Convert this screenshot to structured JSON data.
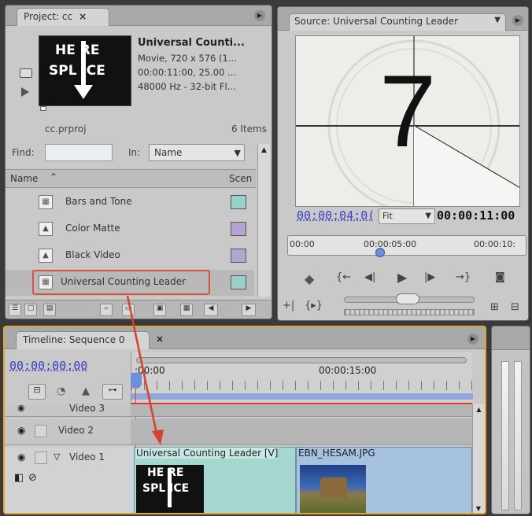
{
  "project": {
    "tab_label": "Project: cc",
    "tab_close": "×",
    "clip_title": "Universal Counti...",
    "clip_line1": "Movie, 720 x 576 (1...",
    "clip_line2": "00:00:11:00, 25.00 ...",
    "clip_line3": "48000 Hz - 32-bit Fl...",
    "thumb_line1": "HE RE",
    "thumb_line2": "SPL ICE",
    "file_name": "cc.prproj",
    "item_count": "6 Items",
    "find_label": "Find:",
    "find_value": "",
    "in_label": "In:",
    "in_value": "Name",
    "col_name": "Name",
    "col_scene": "Scen",
    "items": [
      {
        "label": "Bars and Tone",
        "color": "#9ad0cc"
      },
      {
        "label": "Color Matte",
        "color": "#b3a4d4"
      },
      {
        "label": "Black Video",
        "color": "#b3a4d4"
      },
      {
        "label": "Universal Counting Leader",
        "color": "#9ad0cc"
      }
    ]
  },
  "source": {
    "tab_label": "Source: Universal Counting Leader",
    "preview_number": "7",
    "current_time": "00:00:04:0(",
    "fit_value": "Fit",
    "duration": "00:00:11:00",
    "ruler_start": "00:00",
    "ruler_mid": "00:00:05:00",
    "ruler_end": "00:00:10:"
  },
  "timeline": {
    "tab_label": "Timeline: Sequence 0",
    "tab_close": "×",
    "current_time": "00:00:00:00",
    "ruler_start": ":00:00",
    "ruler_mid": "00:00:15:00",
    "tracks": {
      "video3": "Video 3",
      "video2": "Video 2",
      "video1": "Video 1"
    },
    "clip1_label": "Universal Counting Leader [V]",
    "clip2_label": "EBN_HESAM.JPG"
  },
  "colors": {
    "highlight": "#d9533b",
    "time_blue": "#3b40c4",
    "arrow_red": "#d9402f"
  }
}
